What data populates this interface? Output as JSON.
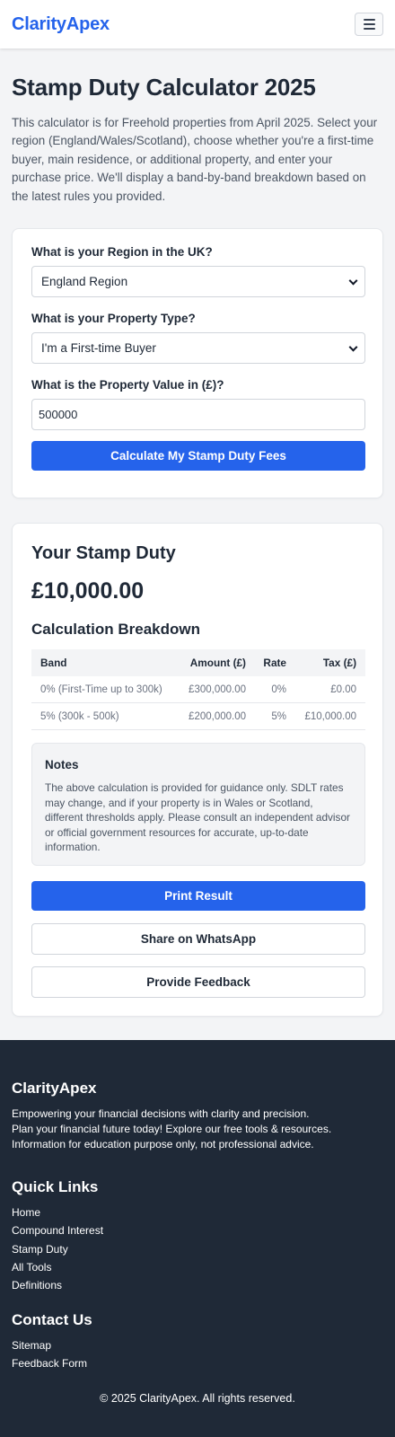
{
  "header": {
    "brand": "ClarityApex",
    "menu_icon": "hamburger-menu-icon"
  },
  "page": {
    "title": "Stamp Duty Calculator 2025",
    "intro": "This calculator is for Freehold properties from April 2025. Select your region (England/Wales/Scotland), choose whether you're a first-time buyer, main residence, or additional property, and enter your purchase price. We'll display a band-by-band breakdown based on the latest rules you provided."
  },
  "form": {
    "region_label": "What is your Region in the UK?",
    "region_value": "England Region",
    "property_type_label": "What is your Property Type?",
    "property_type_value": "I'm a First-time Buyer",
    "value_label": "What is the Property Value in (£)?",
    "value_input": "500000",
    "calculate_label": "Calculate My Stamp Duty Fees"
  },
  "result": {
    "heading": "Your Stamp Duty",
    "amount": "£10,000.00",
    "breakdown_title": "Calculation Breakdown",
    "table": {
      "headers": [
        "Band",
        "Amount (£)",
        "Rate",
        "Tax (£)"
      ],
      "rows": [
        [
          "0% (First-Time up to 300k)",
          "£300,000.00",
          "0%",
          "£0.00"
        ],
        [
          "5% (300k - 500k)",
          "£200,000.00",
          "5%",
          "£10,000.00"
        ]
      ]
    },
    "notes_title": "Notes",
    "notes_text": "The above calculation is provided for guidance only. SDLT rates may change, and if your property is in Wales or Scotland, different thresholds apply. Please consult an independent advisor or official government resources for accurate, up-to-date information.",
    "print_label": "Print Result",
    "whatsapp_label": "Share on WhatsApp",
    "feedback_label": "Provide Feedback"
  },
  "footer": {
    "brand": "ClarityApex",
    "tagline": [
      "Empowering your financial decisions with clarity and precision.",
      "Plan your financial future today! Explore our free tools & resources.",
      "Information for education purpose only, not professional advice."
    ],
    "quick_links_title": "Quick Links",
    "quick_links": [
      "Home",
      "Compound Interest",
      "Stamp Duty",
      "All Tools",
      "Definitions"
    ],
    "contact_title": "Contact Us",
    "contact_links": [
      "Sitemap",
      "Feedback Form"
    ],
    "copyright": "© 2025 ClarityApex. All rights reserved."
  },
  "colors": {
    "brand": "#2563eb",
    "footer_bg": "#1f2937",
    "page_bg": "#f3f4f6"
  }
}
